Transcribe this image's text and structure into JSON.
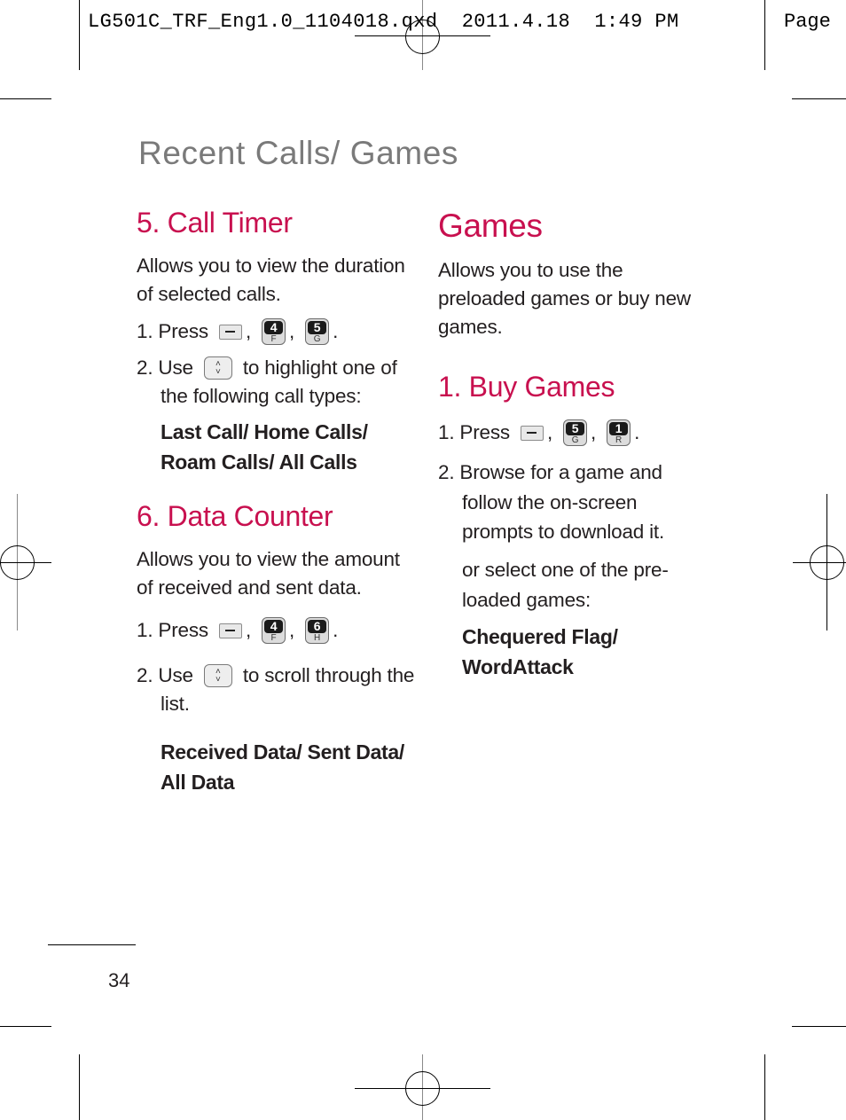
{
  "slug": {
    "filename": "LG501C_TRF_Eng1.0_1104018.qxd",
    "date": "2011.4.18",
    "time": "1:49 PM",
    "page_label": "Page"
  },
  "page_title": "Recent Calls/ Games",
  "call_timer": {
    "heading": "5. Call Timer",
    "description_line1": "Allows you to view the duration",
    "description_line2": "of selected calls.",
    "step1_prefix": "1. Press",
    "step1_keys": [
      {
        "type": "menu-key",
        "label": ""
      },
      {
        "type": "number-key",
        "digit": "4",
        "letter": "F"
      },
      {
        "type": "number-key",
        "digit": "5",
        "letter": "G"
      }
    ],
    "step2_prefix": "2. Use",
    "step2_suffix": "to highlight one of",
    "step2_line2": "the following call types:",
    "options_line1": "Last Call/ Home Calls/",
    "options_line2": "Roam Calls/ All Calls"
  },
  "data_counter": {
    "heading": "6. Data Counter",
    "description_line1": "Allows you to view the amount",
    "description_line2": "of received and sent data.",
    "step1_prefix": "1. Press",
    "step1_keys": [
      {
        "type": "menu-key",
        "label": ""
      },
      {
        "type": "number-key",
        "digit": "4",
        "letter": "F"
      },
      {
        "type": "number-key",
        "digit": "6",
        "letter": "H"
      }
    ],
    "step2_prefix": "2. Use",
    "step2_suffix": "to scroll through the",
    "step2_line2": "list.",
    "options_line1": "Received Data/ Sent Data/",
    "options_line2": "All Data"
  },
  "games": {
    "heading": "Games",
    "description_line1": "Allows you to use the",
    "description_line2": "preloaded games or buy new",
    "description_line3": "games."
  },
  "buy_games": {
    "heading": "1. Buy Games",
    "step1_prefix": "1. Press",
    "step1_keys": [
      {
        "type": "menu-key",
        "label": ""
      },
      {
        "type": "number-key",
        "digit": "5",
        "letter": "G"
      },
      {
        "type": "number-key",
        "digit": "1",
        "letter": "R"
      }
    ],
    "step2_line1": "2. Browse for a game and",
    "step2_line2": "follow the on-screen",
    "step2_line3": "prompts to download it.",
    "alt_line1": "or select one of the pre-",
    "alt_line2": "loaded games:",
    "options_line1": "Chequered Flag/",
    "options_line2": "WordAttack"
  },
  "nav_key": {
    "up": "˄",
    "down": "˅"
  },
  "punct": {
    "comma": ",",
    "period": "."
  },
  "page_number": "34",
  "colors": {
    "heading": "#c8104f",
    "title": "#7a7a7a",
    "body": "#231f20"
  }
}
